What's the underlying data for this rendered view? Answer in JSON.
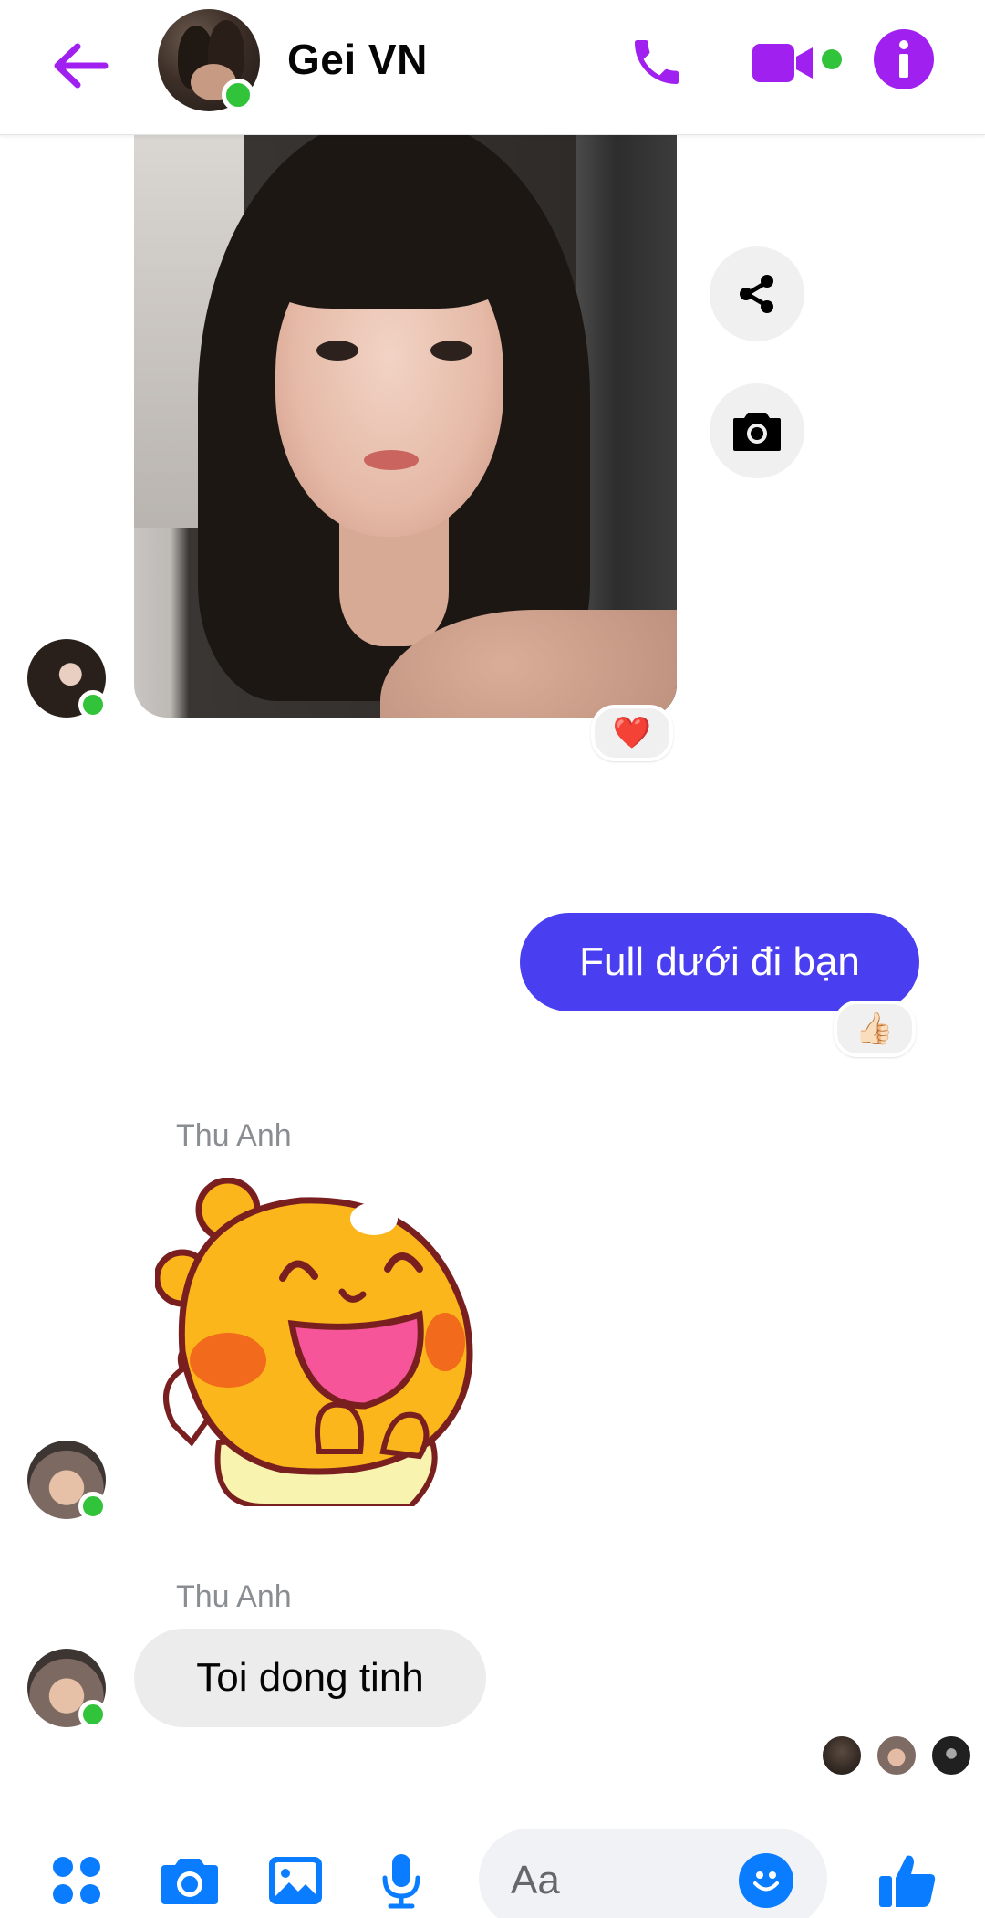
{
  "header": {
    "title": "Gei VN"
  },
  "messages": {
    "photo_reaction": "❤️",
    "outgoing_text": "Full dưới đi bạn",
    "outgoing_reaction": "👍🏻",
    "sticker_sender": "Thu Anh",
    "text_sender": "Thu Anh",
    "incoming_text": "Toi dong tinh"
  },
  "composer": {
    "placeholder": "Aa"
  },
  "colors": {
    "accent_purple": "#a020f0",
    "outgoing_bubble": "#4a3ff0",
    "online_green": "#31c43a",
    "composer_blue": "#0a7cff"
  },
  "icons": [
    "back-arrow-icon",
    "phone-icon",
    "video-camera-icon",
    "info-icon",
    "share-icon",
    "camera-icon",
    "apps-icon",
    "gallery-icon",
    "microphone-icon",
    "emoji-icon",
    "thumbs-up-icon"
  ]
}
